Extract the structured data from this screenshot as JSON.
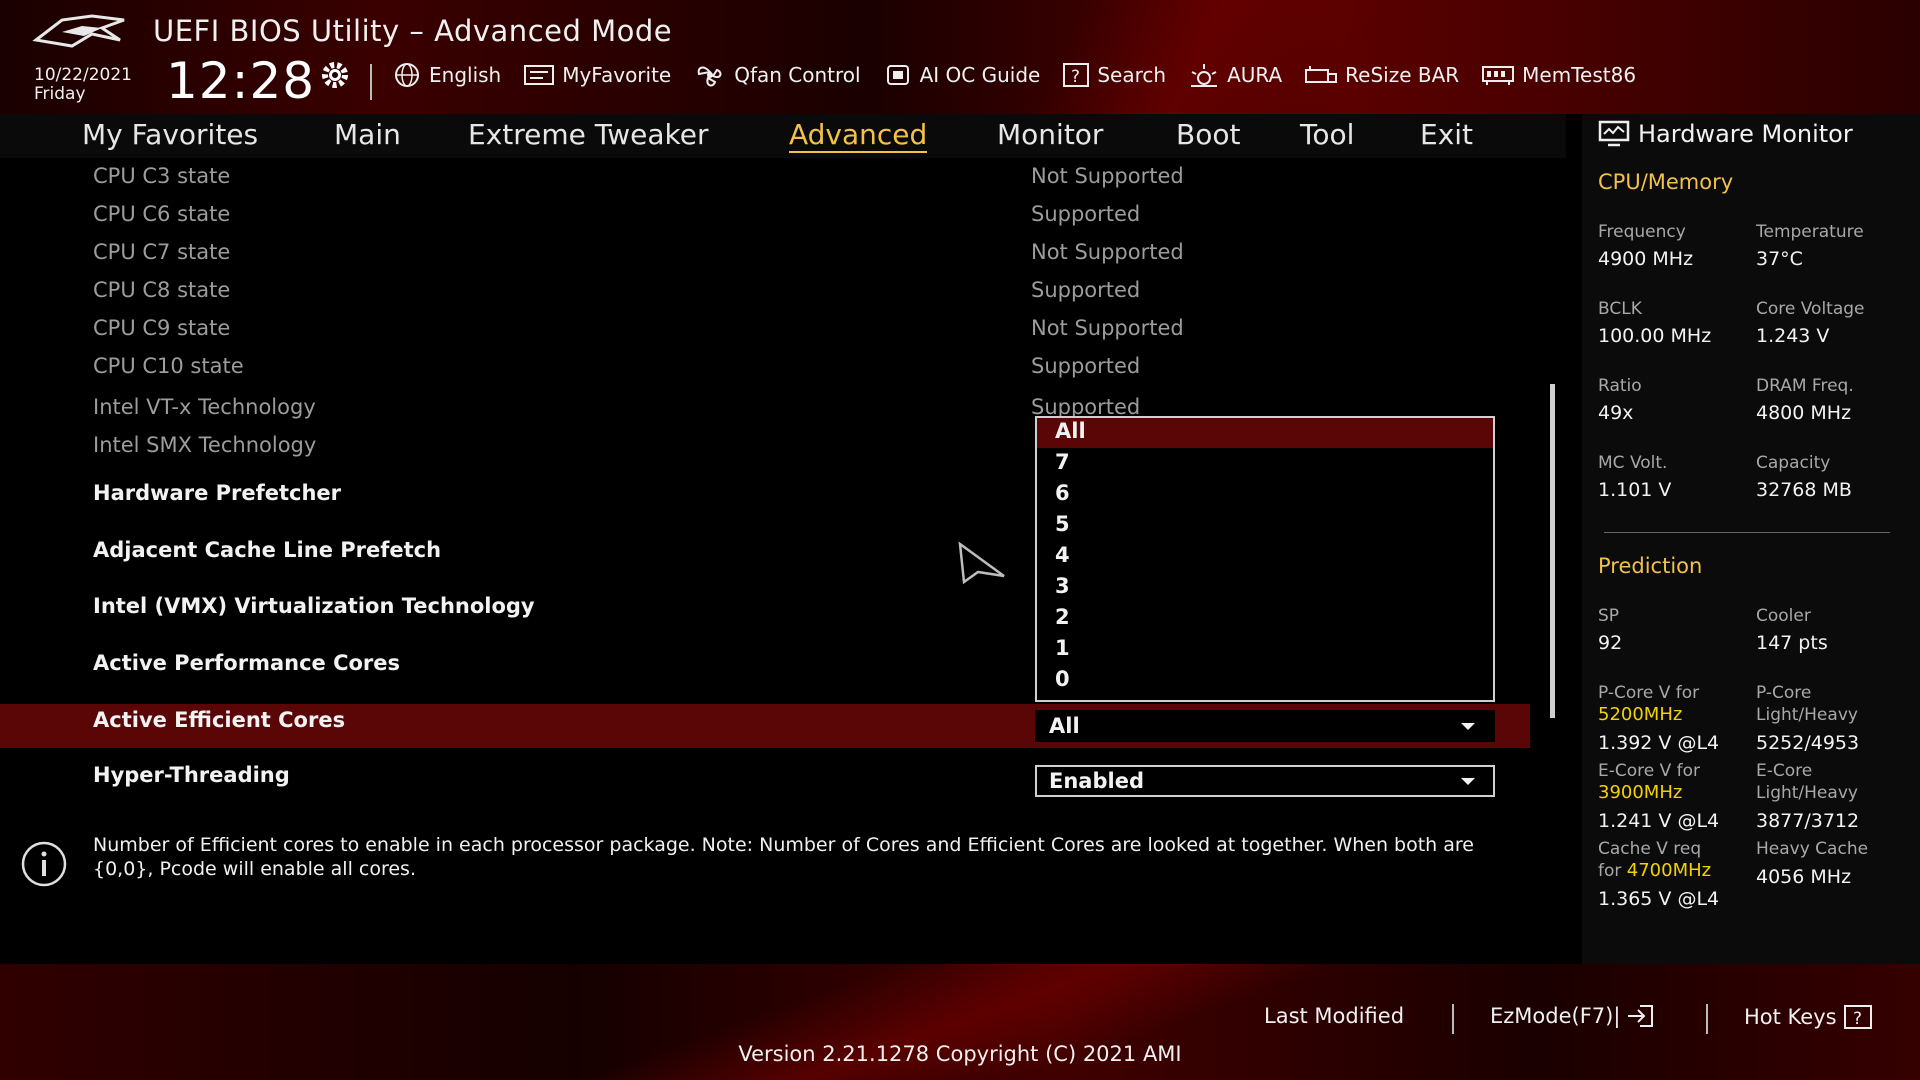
{
  "header": {
    "title": "UEFI BIOS Utility – Advanced Mode",
    "date": "10/22/2021",
    "day": "Friday",
    "time": "12:28",
    "toolbar": [
      {
        "label": "English",
        "icon": "globe-icon"
      },
      {
        "label": "MyFavorite",
        "icon": "favorite-icon"
      },
      {
        "label": "Qfan Control",
        "icon": "fan-icon"
      },
      {
        "label": "AI OC Guide",
        "icon": "ai-chip-icon"
      },
      {
        "label": "Search",
        "icon": "question-box-icon"
      },
      {
        "label": "AURA",
        "icon": "aura-light-icon"
      },
      {
        "label": "ReSize BAR",
        "icon": "resize-bar-icon"
      },
      {
        "label": "MemTest86",
        "icon": "memory-icon"
      }
    ]
  },
  "tabs": [
    "My Favorites",
    "Main",
    "Extreme Tweaker",
    "Advanced",
    "Monitor",
    "Boot",
    "Tool",
    "Exit"
  ],
  "active_tab": "Advanced",
  "settings": [
    {
      "label": "CPU C3 state",
      "value": "Not Supported"
    },
    {
      "label": "CPU C6 state",
      "value": "Supported"
    },
    {
      "label": "CPU C7 state",
      "value": "Not Supported"
    },
    {
      "label": "CPU C8 state",
      "value": "Supported"
    },
    {
      "label": "CPU C9 state",
      "value": "Not Supported"
    },
    {
      "label": "CPU C10 state",
      "value": "Supported"
    },
    {
      "label": "Intel VT-x Technology",
      "value": "Supported"
    },
    {
      "label": "Intel SMX Technology",
      "value": ""
    },
    {
      "label": "Hardware Prefetcher"
    },
    {
      "label": "Adjacent Cache Line Prefetch"
    },
    {
      "label": "Intel (VMX) Virtualization Technology"
    },
    {
      "label": "Active Performance Cores"
    },
    {
      "label": "Active Efficient Cores",
      "value": "All"
    },
    {
      "label": "Hyper-Threading",
      "value": "Enabled"
    }
  ],
  "dropdown": {
    "options": [
      "All",
      "7",
      "6",
      "5",
      "4",
      "3",
      "2",
      "1",
      "0"
    ],
    "highlighted": "All"
  },
  "help_text": "Number of Efficient cores to enable in each processor package. Note: Number of Cores and Efficient Cores are looked at together. When both are {0,0}, Pcode will enable all cores.",
  "hardware_monitor": {
    "title": "Hardware Monitor",
    "cpu_memory": {
      "section": "CPU/Memory",
      "items": [
        {
          "label": "Frequency",
          "value": "4900 MHz"
        },
        {
          "label": "Temperature",
          "value": "37°C"
        },
        {
          "label": "BCLK",
          "value": "100.00 MHz"
        },
        {
          "label": "Core Voltage",
          "value": "1.243 V"
        },
        {
          "label": "Ratio",
          "value": "49x"
        },
        {
          "label": "DRAM Freq.",
          "value": "4800 MHz"
        },
        {
          "label": "MC Volt.",
          "value": "1.101 V"
        },
        {
          "label": "Capacity",
          "value": "32768 MB"
        }
      ]
    },
    "prediction": {
      "section": "Prediction",
      "sp_label": "SP",
      "sp_value": "92",
      "cooler_label": "Cooler",
      "cooler_value": "147 pts",
      "pcore_v_label": "P-Core V for",
      "pcore_v_freq": "5200MHz",
      "pcore_v_value": "1.392 V @L4",
      "pcore_lh_label1": "P-Core",
      "pcore_lh_label2": "Light/Heavy",
      "pcore_lh_value": "5252/4953",
      "ecore_v_label": "E-Core V for",
      "ecore_v_freq": "3900MHz",
      "ecore_v_value": "1.241 V @L4",
      "ecore_lh_label1": "E-Core",
      "ecore_lh_label2": "Light/Heavy",
      "ecore_lh_value": "3877/3712",
      "cache_v_label1": "Cache V req",
      "cache_v_label2": "for",
      "cache_v_freq": "4700MHz",
      "cache_v_value": "1.365 V @L4",
      "heavy_cache_label": "Heavy Cache",
      "heavy_cache_value": "4056 MHz"
    }
  },
  "footer": {
    "last_modified": "Last Modified",
    "ezmode": "EzMode(F7)|",
    "hotkeys": "Hot Keys",
    "version": "Version 2.21.1278 Copyright (C) 2021 AMI"
  },
  "colors": {
    "accent": "#f2c14a",
    "selection": "#5a0606",
    "highlight_freq": "#f2d200"
  }
}
